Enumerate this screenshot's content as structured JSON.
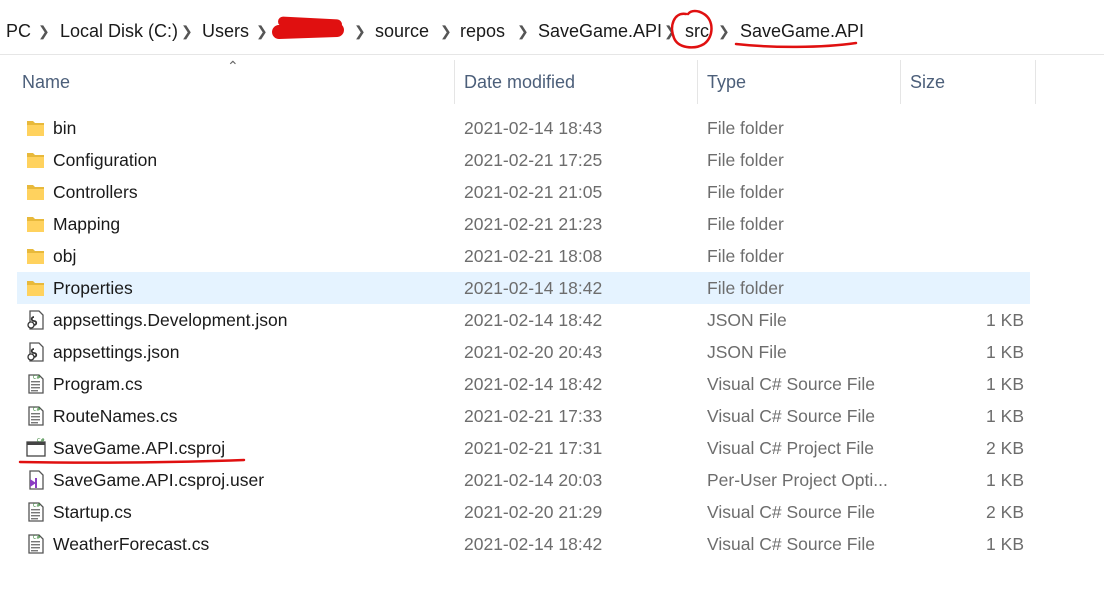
{
  "breadcrumb": {
    "items": [
      "PC",
      "Local Disk (C:)",
      "Users",
      "",
      "source",
      "repos",
      "SaveGame.API",
      "src",
      "SaveGame.API"
    ]
  },
  "columns": {
    "name": "Name",
    "date": "Date modified",
    "type": "Type",
    "size": "Size"
  },
  "selection_color": "#e5f3ff",
  "annotation_color": "#e01010",
  "files": [
    {
      "name": "bin",
      "date": "2021-02-14 18:43",
      "type": "File folder",
      "size": "",
      "icon": "folder-icon"
    },
    {
      "name": "Configuration",
      "date": "2021-02-21 17:25",
      "type": "File folder",
      "size": "",
      "icon": "folder-icon"
    },
    {
      "name": "Controllers",
      "date": "2021-02-21 21:05",
      "type": "File folder",
      "size": "",
      "icon": "folder-icon"
    },
    {
      "name": "Mapping",
      "date": "2021-02-21 21:23",
      "type": "File folder",
      "size": "",
      "icon": "folder-icon"
    },
    {
      "name": "obj",
      "date": "2021-02-21 18:08",
      "type": "File folder",
      "size": "",
      "icon": "folder-icon"
    },
    {
      "name": "Properties",
      "date": "2021-02-14 18:42",
      "type": "File folder",
      "size": "",
      "icon": "folder-icon",
      "selected": true
    },
    {
      "name": "appsettings.Development.json",
      "date": "2021-02-14 18:42",
      "type": "JSON File",
      "size": "1 KB",
      "icon": "json-file-icon"
    },
    {
      "name": "appsettings.json",
      "date": "2021-02-20 20:43",
      "type": "JSON File",
      "size": "1 KB",
      "icon": "json-file-icon"
    },
    {
      "name": "Program.cs",
      "date": "2021-02-14 18:42",
      "type": "Visual C# Source File",
      "size": "1 KB",
      "icon": "csharp-file-icon"
    },
    {
      "name": "RouteNames.cs",
      "date": "2021-02-21 17:33",
      "type": "Visual C# Source File",
      "size": "1 KB",
      "icon": "csharp-file-icon"
    },
    {
      "name": "SaveGame.API.csproj",
      "date": "2021-02-21 17:31",
      "type": "Visual C# Project File",
      "size": "2 KB",
      "icon": "csproj-file-icon"
    },
    {
      "name": "SaveGame.API.csproj.user",
      "date": "2021-02-14 20:03",
      "type": "Per-User Project Opti...",
      "size": "1 KB",
      "icon": "vs-user-file-icon"
    },
    {
      "name": "Startup.cs",
      "date": "2021-02-20 21:29",
      "type": "Visual C# Source File",
      "size": "2 KB",
      "icon": "csharp-file-icon"
    },
    {
      "name": "WeatherForecast.cs",
      "date": "2021-02-14 18:42",
      "type": "Visual C# Source File",
      "size": "1 KB",
      "icon": "csharp-file-icon"
    }
  ]
}
